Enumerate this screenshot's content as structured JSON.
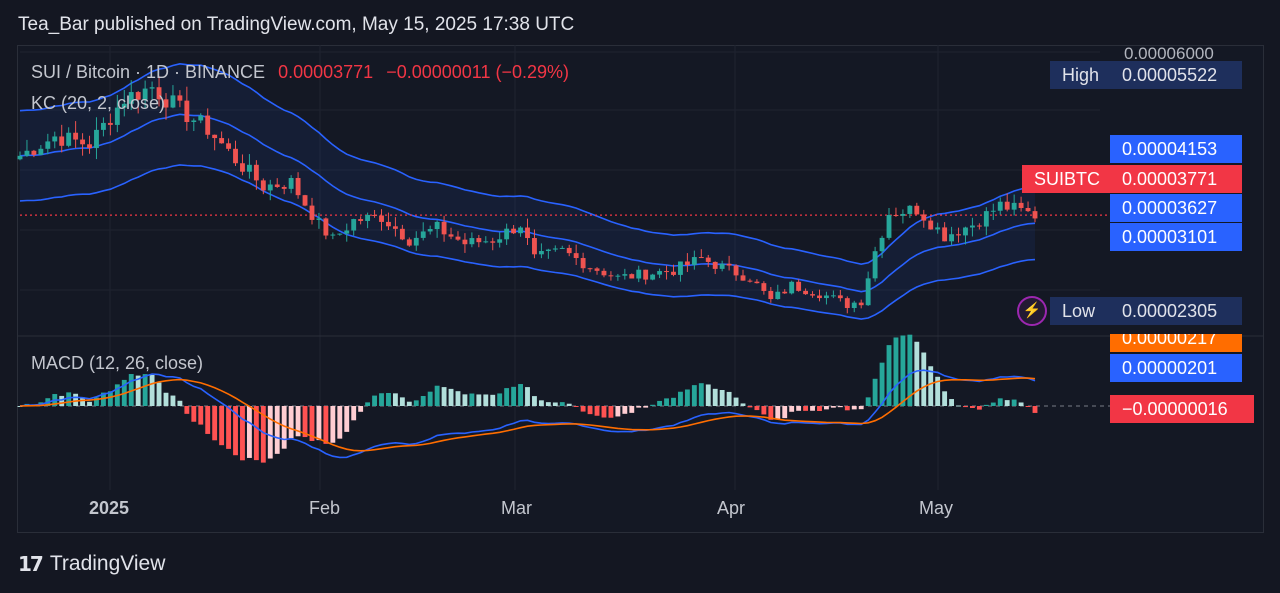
{
  "header": {
    "text": "Tea_Bar published on TradingView.com, May 15, 2025 17:38 UTC"
  },
  "legend": {
    "symbol": "SUI / Bitcoin · 1D · BINANCE",
    "price": "0.00003771",
    "change": "−0.00000011 (−0.29%)",
    "kc": "KC (20, 2, close)",
    "macd": "MACD (12, 26, close)"
  },
  "price_axis": {
    "top_label": "0.00006000",
    "high": {
      "label": "High",
      "value": "0.00005522"
    },
    "upper": "0.00004153",
    "current": {
      "label": "SUIBTC",
      "value": "0.00003771"
    },
    "middle": "0.00003627",
    "lower": "0.00003101",
    "low": {
      "label": "Low",
      "value": "0.00002305"
    }
  },
  "macd_axis": {
    "signal": "0.00000217",
    "macd": "0.00000201",
    "hist": "−0.00000016"
  },
  "time_axis": [
    "2025",
    "Feb",
    "Mar",
    "Apr",
    "May"
  ],
  "footer": {
    "logo": "TradingView"
  },
  "colors": {
    "up": "#26a69a",
    "down": "#ef5350",
    "kc_band": "#2962ff",
    "macd_line": "#2962ff",
    "signal_line": "#ff6d00",
    "hist_up_strong": "#26a69a",
    "hist_up_weak": "#b2dfdb",
    "hist_down_strong": "#ff5252",
    "hist_down_weak": "#ffcdd2"
  },
  "chart_data": {
    "type": "candlestick",
    "symbol": "SUIBTC",
    "interval": "1D",
    "exchange": "BINANCE",
    "x_range": [
      "2024-12-20",
      "2025-05-15"
    ],
    "ylim": [
      2.2e-05,
      6e-05
    ],
    "close_series": {
      "x": [
        "2024-12-20",
        "2024-12-25",
        "2024-12-30",
        "2025-01-04",
        "2025-01-08",
        "2025-01-12",
        "2025-01-16",
        "2025-01-20",
        "2025-01-24",
        "2025-01-28",
        "2025-02-01",
        "2025-02-03",
        "2025-02-06",
        "2025-02-10",
        "2025-02-14",
        "2025-02-18",
        "2025-02-22",
        "2025-02-26",
        "2025-03-02",
        "2025-03-04",
        "2025-03-08",
        "2025-03-12",
        "2025-03-16",
        "2025-03-20",
        "2025-03-24",
        "2025-03-28",
        "2025-04-01",
        "2025-04-04",
        "2025-04-07",
        "2025-04-10",
        "2025-04-14",
        "2025-04-18",
        "2025-04-20",
        "2025-04-22",
        "2025-04-24",
        "2025-04-28",
        "2025-05-02",
        "2025-05-06",
        "2025-05-10",
        "2025-05-15"
      ],
      "close": [
        4.55e-05,
        4.8e-05,
        4.7e-05,
        5.3e-05,
        5.45e-05,
        5.15e-05,
        4.9e-05,
        4.5e-05,
        4.15e-05,
        4.2e-05,
        3.65e-05,
        3.45e-05,
        3.7e-05,
        3.75e-05,
        3.45e-05,
        3.6e-05,
        3.4e-05,
        3.45e-05,
        3.65e-05,
        3.2e-05,
        3.3e-05,
        3.1e-05,
        2.95e-05,
        3e-05,
        3.05e-05,
        3.2e-05,
        3.05e-05,
        2.95e-05,
        2.65e-05,
        2.85e-05,
        2.75e-05,
        2.6e-05,
        2.65e-05,
        3.3e-05,
        3.8e-05,
        3.85e-05,
        3.5e-05,
        3.65e-05,
        3.9e-05,
        3.771e-05
      ]
    },
    "high": 5.522e-05,
    "low": 2.305e-05,
    "last": 3.771e-05,
    "change": -1.1e-07,
    "change_pct": -0.29,
    "keltner": {
      "length": 20,
      "mult": 2,
      "source": "close",
      "upper": 4.153e-05,
      "middle": 3.627e-05,
      "lower": 3.101e-05
    },
    "macd": {
      "fast": 12,
      "slow": 26,
      "source": "close",
      "macd": 2.01e-06,
      "signal": 2.17e-06,
      "histogram": -1.6e-07
    },
    "x_ticks": [
      "2025",
      "Feb",
      "Mar",
      "Apr",
      "May"
    ],
    "grid": true
  }
}
